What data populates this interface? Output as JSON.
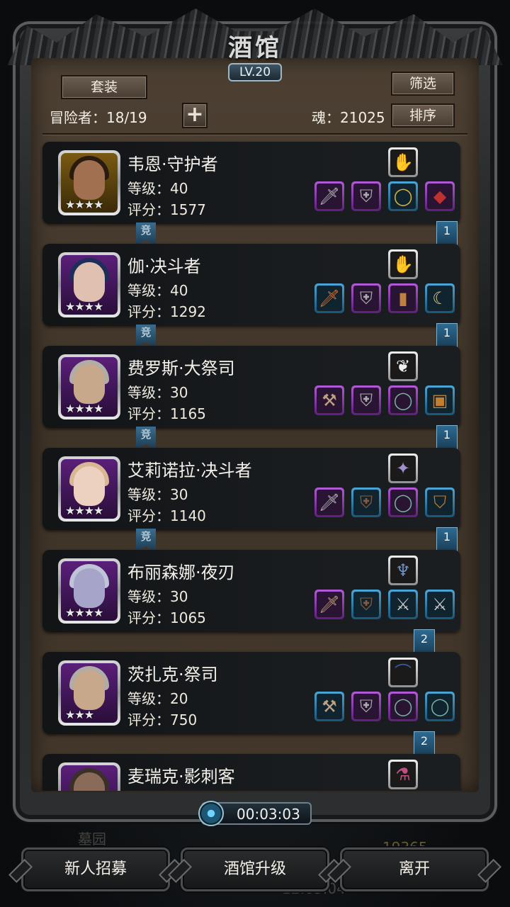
{
  "header": {
    "title": "酒馆",
    "level": "LV.20"
  },
  "toolbar": {
    "set_label": "套装",
    "filter_label": "筛选",
    "sort_label": "排序",
    "adventurers_text": "冒险者：18/19",
    "soul_text": "魂：21025"
  },
  "heroes": [
    {
      "name": "韦恩·守护者",
      "level_text": "等级：40",
      "score_text": "评分：1577",
      "stars": "★★★★",
      "comp": "竞",
      "rank": "1"
    },
    {
      "name": "伽·决斗者",
      "level_text": "等级：40",
      "score_text": "评分：1292",
      "stars": "★★★★",
      "comp": "竞",
      "rank": "1"
    },
    {
      "name": "费罗斯·大祭司",
      "level_text": "等级：30",
      "score_text": "评分：1165",
      "stars": "★★★★",
      "comp": "竞",
      "rank": "1"
    },
    {
      "name": "艾莉诺拉·决斗者",
      "level_text": "等级：30",
      "score_text": "评分：1140",
      "stars": "★★★★",
      "comp": "竞",
      "rank": "1"
    },
    {
      "name": "布丽森娜·夜刃",
      "level_text": "等级：30",
      "score_text": "评分：1065",
      "stars": "★★★★",
      "comp": "",
      "rank": "2"
    },
    {
      "name": "茨扎克·祭司",
      "level_text": "等级：20",
      "score_text": "评分：750",
      "stars": "★★★",
      "comp": "",
      "rank": "2"
    },
    {
      "name": "麦瑞克·影刺客",
      "level_text": "",
      "score_text": "",
      "stars": "",
      "comp": "",
      "rank": ""
    }
  ],
  "timer": {
    "text": "00:03:03"
  },
  "background": {
    "graveyard": "墓园",
    "gold": "19365",
    "clock": "12:05:04"
  },
  "footer": {
    "recruit_label": "新人招募",
    "upgrade_label": "酒馆升级",
    "leave_label": "离开"
  }
}
